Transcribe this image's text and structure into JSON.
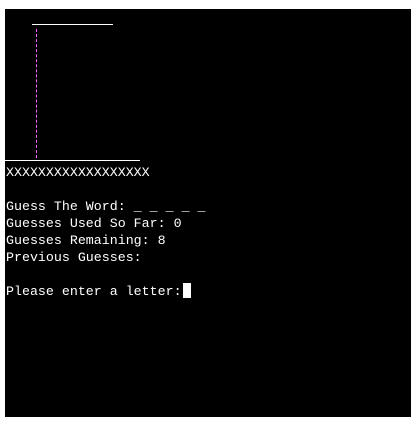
{
  "ground_pattern": "XXXXXXXXXXXXXXXXXX",
  "status": {
    "word_label": "Guess The Word:",
    "word_blanks": "_ _ _ _ _",
    "used_label": "Guesses Used So Far:",
    "used_value": "0",
    "remaining_label": "Guesses Remaining:",
    "remaining_value": "8",
    "previous_label": "Previous Guesses:",
    "previous_value": ""
  },
  "prompt": {
    "text": "Please enter a letter:"
  },
  "colors": {
    "background": "#000000",
    "text": "#ffffff",
    "rope": "#ff66ff"
  }
}
